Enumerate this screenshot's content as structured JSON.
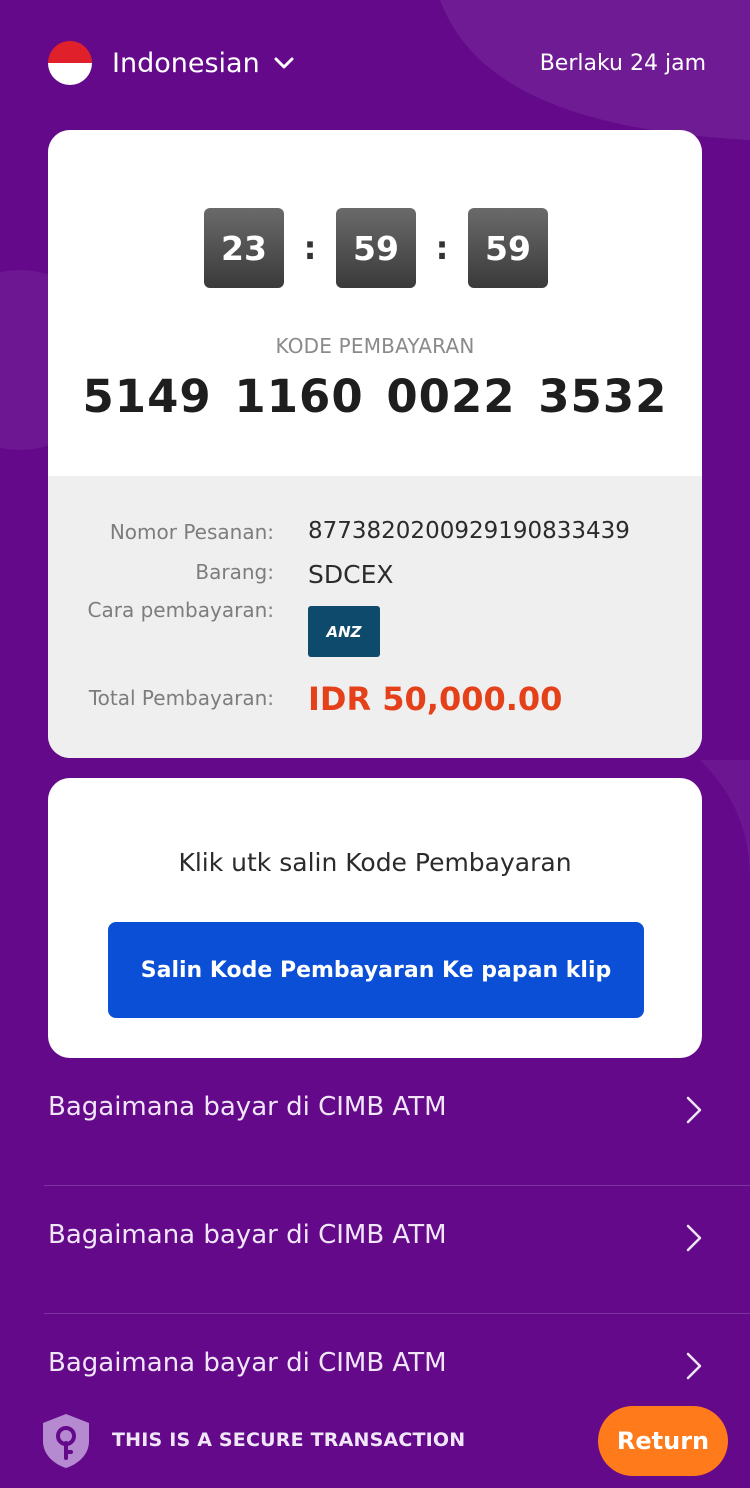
{
  "colors": {
    "background": "#63098a",
    "primary_button": "#0a4fd6",
    "amount": "#e4401a",
    "return_button": "#ff7a1a",
    "anz_brand": "#0e4a6b"
  },
  "header": {
    "language": "Indonesian",
    "language_flag": "indonesia-flag",
    "validity": "Berlaku 24 jam"
  },
  "timer": {
    "hours": "23",
    "minutes": "59",
    "seconds": "59",
    "separator": ":"
  },
  "payment_code": {
    "label": "KODE PEMBAYARAN",
    "value": "5149 1160 0022 3532"
  },
  "details": {
    "order_number_label": "Nomor Pesanan:",
    "order_number": "877382020092919083343​9",
    "item_label": "Barang:",
    "item": "SDCEX",
    "payment_method_label": "Cara pembayaran:",
    "payment_method_logo": "ANZ",
    "total_label": "Total Pembayaran:",
    "total": "IDR 50,000.00"
  },
  "copy": {
    "hint": "Klik utk salin Kode Pembayaran",
    "button_label": "Salin Kode Pembayaran Ke papan klip"
  },
  "howto_items": [
    {
      "label": "Bagaimana bayar di CIMB ATM"
    },
    {
      "label": "Bagaimana bayar di CIMB ATM"
    },
    {
      "label": "Bagaimana bayar di CIMB ATM"
    }
  ],
  "footer": {
    "secure_text": "THIS IS A SECURE TRANSACTION",
    "return_label": "Return"
  }
}
